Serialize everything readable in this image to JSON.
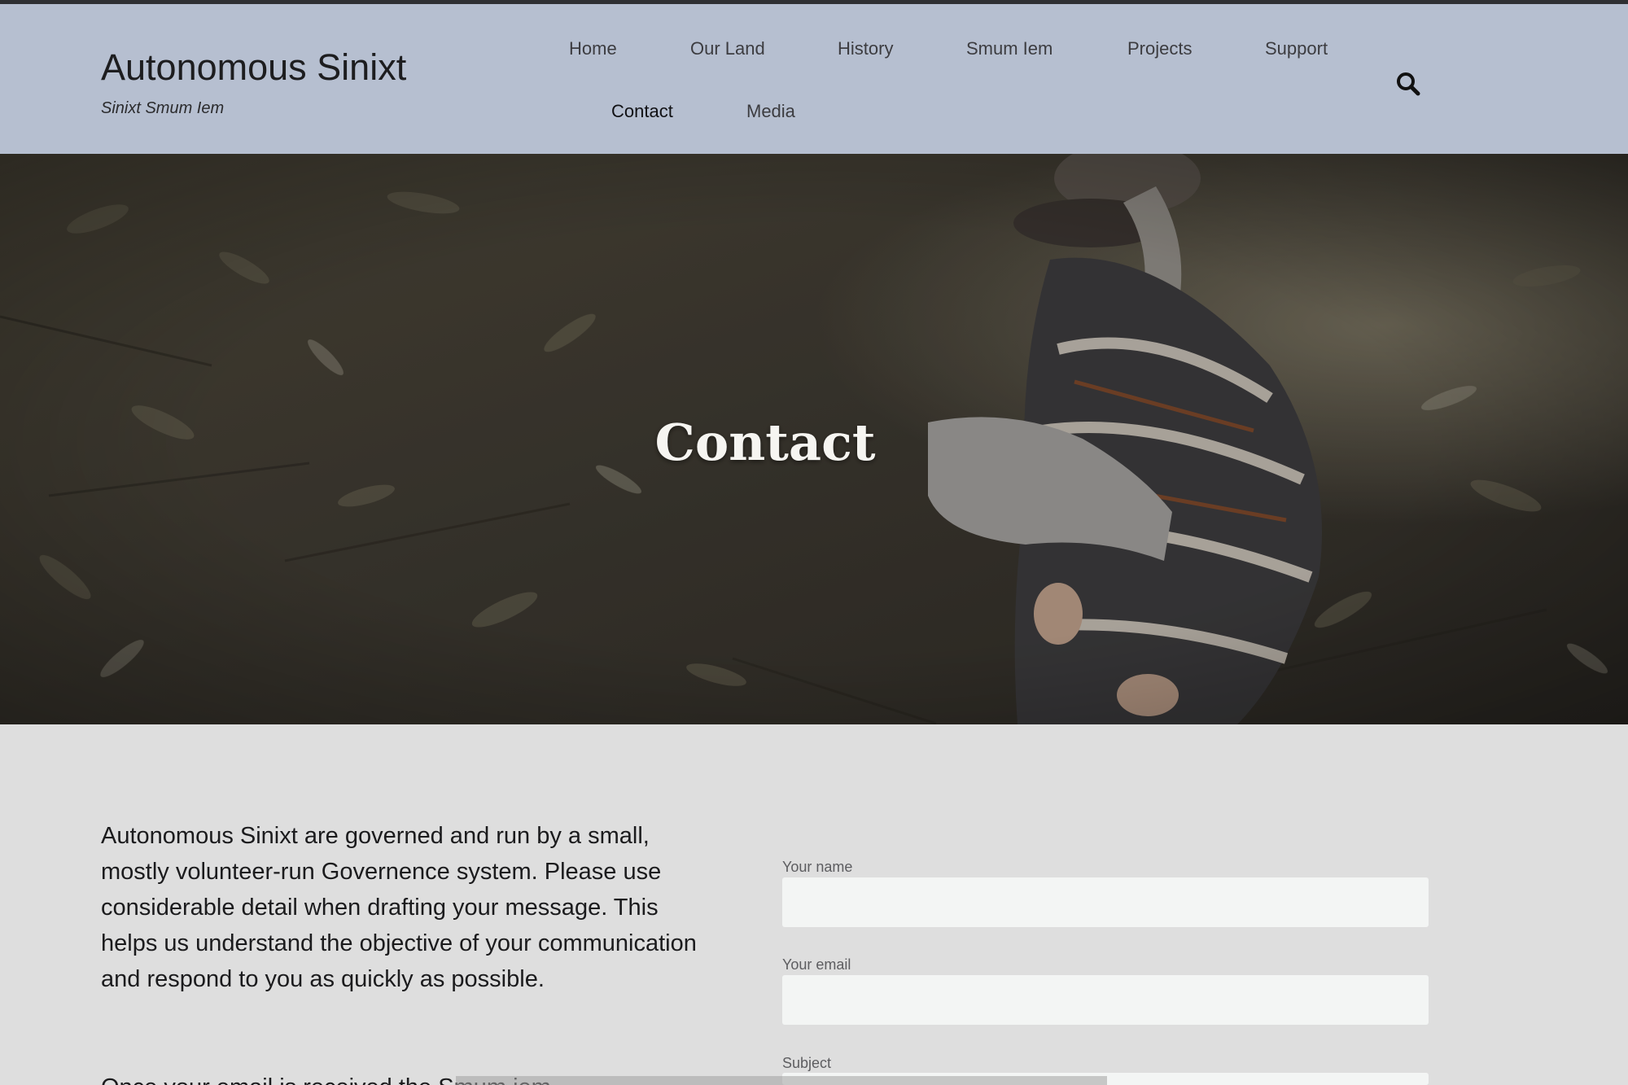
{
  "site": {
    "title": "Autonomous Sinixt",
    "tagline": "Sinixt Smum Iem"
  },
  "nav": {
    "items": [
      {
        "label": "Home"
      },
      {
        "label": "Our Land"
      },
      {
        "label": "History"
      },
      {
        "label": "Smum Iem"
      },
      {
        "label": "Projects"
      },
      {
        "label": "Support"
      },
      {
        "label": "Contact",
        "active": true
      },
      {
        "label": "Media"
      }
    ],
    "search_icon": "search-icon"
  },
  "hero": {
    "title": "Contact"
  },
  "intro": {
    "paragraph": "Autonomous Sinixt are governed and run by a small, mostly volunteer-run Governence system. Please use considerable detail when drafting your message. This helps us understand the objective of your communication and respond to you as quickly as possible.",
    "next_paragraph_start": "Once your email is received the Smum iem"
  },
  "form": {
    "name_label": "Your name",
    "name_value": "",
    "email_label": "Your email",
    "email_value": "",
    "subject_label": "Subject",
    "subject_value": ""
  },
  "colors": {
    "header_bg": "#b6bfd0",
    "page_bg": "#dedede",
    "input_bg": "#f3f5f4",
    "topbar": "#2f3033"
  }
}
